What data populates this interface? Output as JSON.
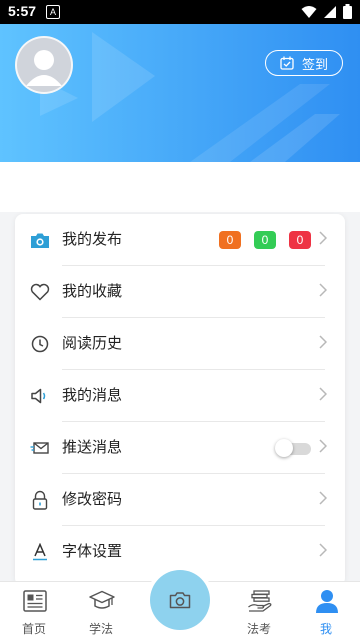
{
  "status_bar": {
    "time": "5:57",
    "notification_glyph": "A"
  },
  "profile": {
    "signin_label": "签到"
  },
  "menu": {
    "items": [
      {
        "label": "我的发布",
        "icon": "camera-icon"
      },
      {
        "label": "我的收藏",
        "icon": "heart-icon"
      },
      {
        "label": "阅读历史",
        "icon": "clock-icon"
      },
      {
        "label": "我的消息",
        "icon": "speaker-icon"
      },
      {
        "label": "推送消息",
        "icon": "envelope-icon"
      },
      {
        "label": "修改密码",
        "icon": "lock-icon"
      },
      {
        "label": "字体设置",
        "icon": "font-icon"
      }
    ],
    "badges": [
      {
        "value": "0",
        "color": "#f07020"
      },
      {
        "value": "0",
        "color": "#33cc55"
      },
      {
        "value": "0",
        "color": "#ee3344"
      }
    ],
    "push_enabled": false
  },
  "nav": {
    "items": [
      {
        "label": "首页",
        "icon": "newspaper-icon"
      },
      {
        "label": "学法",
        "icon": "graduation-cap-icon"
      },
      {
        "label": "法考",
        "icon": "books-hand-icon"
      },
      {
        "label": "我",
        "icon": "person-icon",
        "active_color": "#2f8ff2"
      }
    ]
  },
  "colors": {
    "accent": "#2f8ff2",
    "header_start": "#5fc3ff",
    "camera_button": "#8ed2ee"
  }
}
